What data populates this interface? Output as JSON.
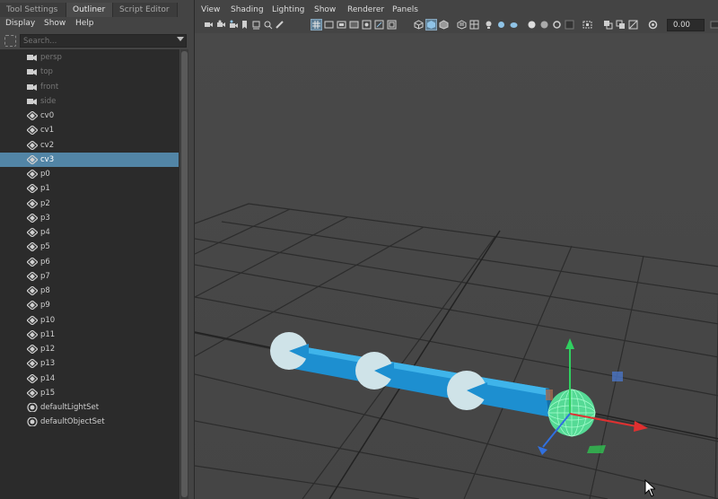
{
  "left_panel": {
    "tabs": [
      {
        "label": "Tool Settings"
      },
      {
        "label": "Outliner"
      },
      {
        "label": "Script Editor"
      }
    ],
    "menu": [
      "Display",
      "Show",
      "Help"
    ],
    "search": {
      "placeholder": "Search..."
    },
    "outliner_items": [
      {
        "label": "persp",
        "icon": "camera-icon",
        "dim": true
      },
      {
        "label": "top",
        "icon": "camera-icon",
        "dim": true
      },
      {
        "label": "front",
        "icon": "camera-icon",
        "dim": true
      },
      {
        "label": "side",
        "icon": "camera-icon",
        "dim": true
      },
      {
        "label": "cv0",
        "icon": "transform-icon"
      },
      {
        "label": "cv1",
        "icon": "transform-icon"
      },
      {
        "label": "cv2",
        "icon": "transform-icon"
      },
      {
        "label": "cv3",
        "icon": "transform-icon",
        "selected": true
      },
      {
        "label": "p0",
        "icon": "transform-icon"
      },
      {
        "label": "p1",
        "icon": "transform-icon"
      },
      {
        "label": "p2",
        "icon": "transform-icon"
      },
      {
        "label": "p3",
        "icon": "transform-icon"
      },
      {
        "label": "p4",
        "icon": "transform-icon"
      },
      {
        "label": "p5",
        "icon": "transform-icon"
      },
      {
        "label": "p6",
        "icon": "transform-icon"
      },
      {
        "label": "p7",
        "icon": "transform-icon"
      },
      {
        "label": "p8",
        "icon": "transform-icon"
      },
      {
        "label": "p9",
        "icon": "transform-icon"
      },
      {
        "label": "p10",
        "icon": "transform-icon"
      },
      {
        "label": "p11",
        "icon": "transform-icon"
      },
      {
        "label": "p12",
        "icon": "transform-icon"
      },
      {
        "label": "p13",
        "icon": "transform-icon"
      },
      {
        "label": "p14",
        "icon": "transform-icon"
      },
      {
        "label": "p15",
        "icon": "transform-icon"
      },
      {
        "label": "defaultLightSet",
        "icon": "set-icon"
      },
      {
        "label": "defaultObjectSet",
        "icon": "set-icon"
      }
    ]
  },
  "viewport": {
    "menu": [
      "View",
      "Shading",
      "Lighting",
      "Show",
      "Renderer",
      "Panels"
    ],
    "exposure_value": "0.00",
    "colors": {
      "selection": "#5285a6",
      "tube": "#1e9fdb",
      "sphere": "#d4e6ea",
      "selected_wire": "#5ff0a8",
      "axis_x": "#e03030",
      "axis_y": "#30d060",
      "axis_z": "#3070e0"
    }
  }
}
